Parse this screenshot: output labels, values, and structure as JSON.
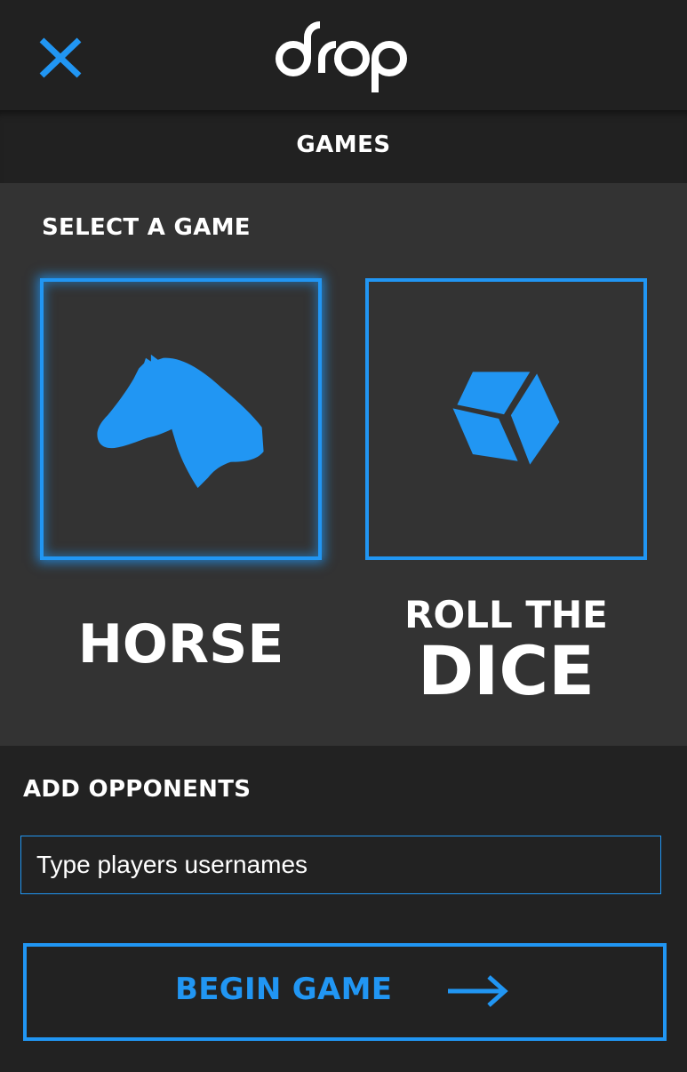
{
  "app": {
    "logo_text": "drop"
  },
  "header": {
    "section_title": "GAMES"
  },
  "games": {
    "heading": "SELECT A GAME",
    "items": [
      {
        "icon": "horse-head-icon",
        "label": "HORSE",
        "selected": true
      },
      {
        "icon": "dice-icon",
        "label_line1": "ROLL THE",
        "label_line2": "DICE",
        "selected": false
      }
    ]
  },
  "opponents": {
    "heading": "ADD OPPONENTS",
    "placeholder": "Type players usernames",
    "value": ""
  },
  "actions": {
    "begin_label": "BEGIN GAME"
  },
  "colors": {
    "accent": "#2196f3",
    "background": "#222222",
    "panel": "#333333",
    "text": "#ffffff"
  }
}
